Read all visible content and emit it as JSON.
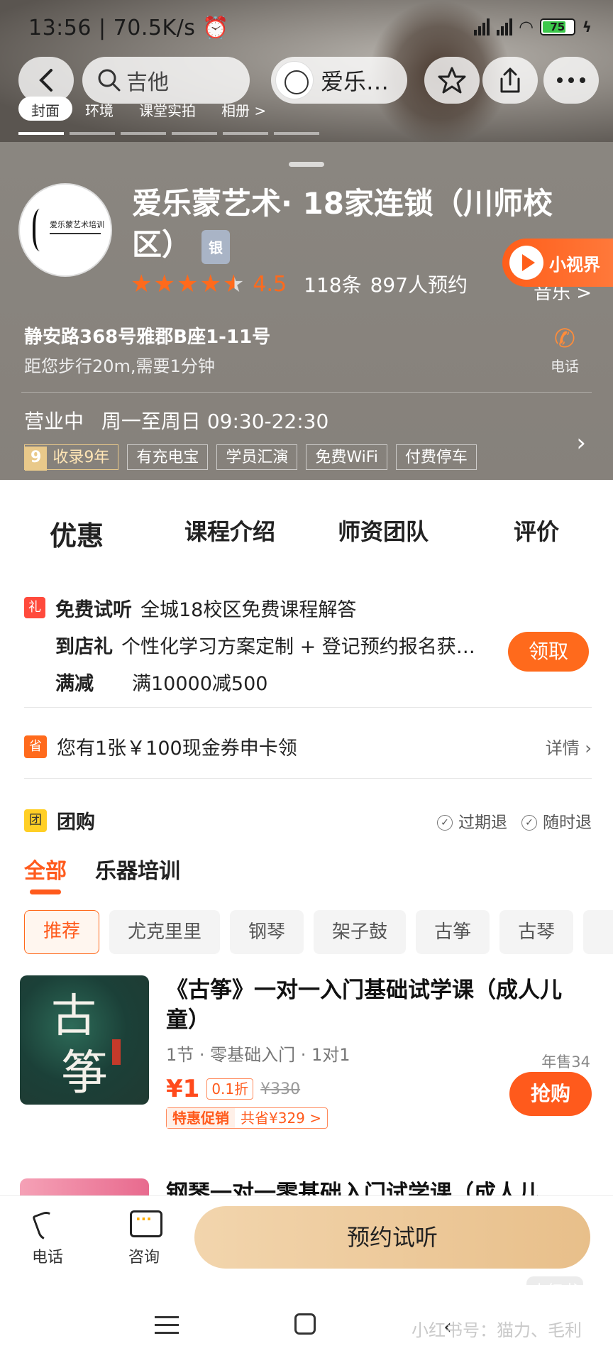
{
  "status_bar": {
    "time": "13:56",
    "speed": "70.5K/s",
    "battery": "75"
  },
  "navbar": {
    "search_text": "吉他",
    "store_short": "爱乐…"
  },
  "photo_tabs": [
    "封面",
    "环境",
    "课堂实拍",
    "相册 >"
  ],
  "shop": {
    "name": "爱乐蒙艺术· 18家连锁（川师校区）",
    "level_badge": "银",
    "logo_text": "爱乐蒙艺术培训",
    "rating": "4.5",
    "reviews": "118条",
    "bookings": "897人预约",
    "video_label": "小视界",
    "category_link": "音乐 >",
    "address": "静安路368号雅郡B座1-11号",
    "distance": "距您步行20m,需要1分钟",
    "phone_label": "电话",
    "status": "营业中",
    "hours": "周一至周日 09:30-22:30",
    "tags": {
      "years_num": "9",
      "years_label": "收录9年",
      "items": [
        "有充电宝",
        "学员汇演",
        "免费WiFi",
        "付费停车"
      ]
    }
  },
  "tabs": [
    "优惠",
    "课程介绍",
    "师资团队",
    "评价"
  ],
  "promo": {
    "gift_icon": "礼",
    "rows": [
      {
        "label": "免费试听",
        "text": "全城18校区免费课程解答"
      },
      {
        "label": "到店礼",
        "text": "个性化学习方案定制 + 登记预约报名获…"
      },
      {
        "label": "满减",
        "text": "满10000减500"
      }
    ],
    "claim_button": "领取"
  },
  "coupon": {
    "icon": "省",
    "text": "您有1张￥100现金券申卡领",
    "detail": "详情"
  },
  "group_buy": {
    "icon": "团",
    "title": "团购",
    "guarantees": [
      "过期退",
      "随时退"
    ],
    "sub_tabs": [
      "全部",
      "乐器培训"
    ],
    "chips": [
      "推荐",
      "尤克里里",
      "钢琴",
      "架子鼓",
      "古筝",
      "古琴"
    ]
  },
  "product1": {
    "thumb_char1": "古",
    "thumb_char2": "筝",
    "name": "《古筝》一对一入门基础试学课（成人儿童）",
    "meta": "1节 · 零基础入门 · 1对1",
    "price": "¥1",
    "discount": "0.1折",
    "original_price": "¥330",
    "promo_label": "特惠促销",
    "promo_save": "共省¥329 >",
    "sold": "年售34",
    "buy_button": "抢购"
  },
  "product2": {
    "name": "钢琴一对一零基础入门试学课（成人儿"
  },
  "bottom_bar": {
    "phone": "电话",
    "consult": "咨询",
    "book": "预约试听"
  },
  "watermark": {
    "text": "小红书号：猫力、毛利",
    "badge": "小红书"
  }
}
